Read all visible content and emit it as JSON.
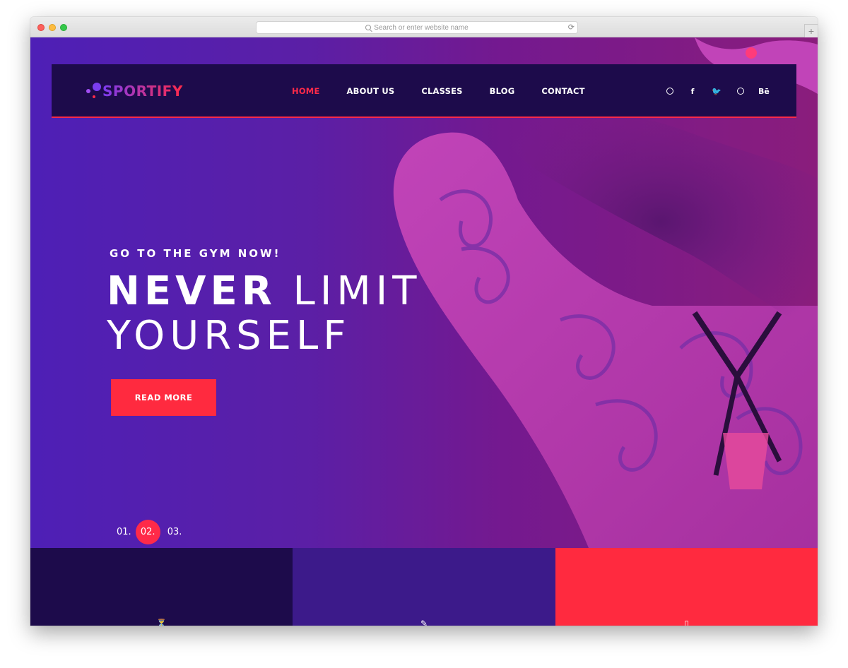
{
  "browser": {
    "url_placeholder": "Search or enter website name",
    "reload_icon": "⟳",
    "new_tab_icon": "+"
  },
  "nav": {
    "brand": "SPORTIFY",
    "items": [
      "HOME",
      "ABOUT US",
      "CLASSES",
      "BLOG",
      "CONTACT"
    ],
    "active": "HOME",
    "social": [
      {
        "name": "pinterest-icon",
        "glyph": "℗"
      },
      {
        "name": "facebook-icon",
        "glyph": "f"
      },
      {
        "name": "twitter-icon",
        "glyph": "🐦"
      },
      {
        "name": "dribbble-icon",
        "glyph": ""
      },
      {
        "name": "behance-icon",
        "glyph": "Bē"
      }
    ]
  },
  "hero": {
    "subtitle": "GO TO THE GYM NOW!",
    "title_bold": "NEVER",
    "title_light": "LIMIT",
    "title_line2": "YOURSELF",
    "cta": "READ MORE",
    "slides": [
      "01.",
      "02.",
      "03."
    ],
    "active_slide": "02."
  },
  "features": [
    {
      "icon": "glass-icon",
      "glyph": "⏳"
    },
    {
      "icon": "dumbbell-icon",
      "glyph": "✎"
    },
    {
      "icon": "phone-icon",
      "glyph": "▯"
    }
  ],
  "colors": {
    "accent": "#ff2a49",
    "navbar": "#1d0b4b",
    "hero_left": "#4e1fb6",
    "hero_right": "#8a1d7c",
    "feature_mid": "#3c1a8a"
  }
}
